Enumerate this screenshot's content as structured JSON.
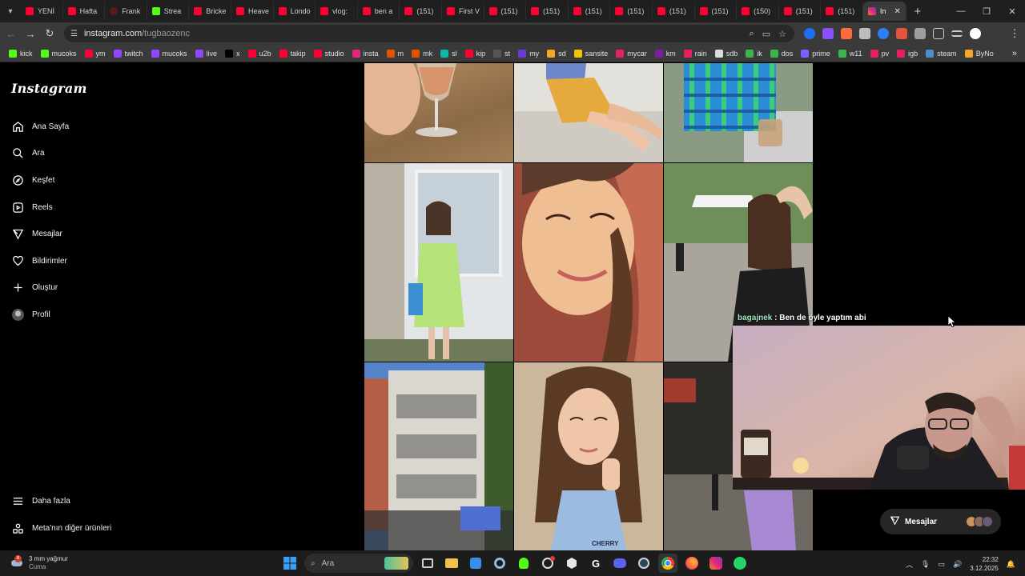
{
  "browser": {
    "tabs": [
      {
        "label": "YENİ",
        "icon": "youtube"
      },
      {
        "label": "Hafta",
        "icon": "youtube"
      },
      {
        "label": "Frank",
        "icon": "frank"
      },
      {
        "label": "Strea",
        "icon": "kick"
      },
      {
        "label": "Bricke",
        "icon": "youtube"
      },
      {
        "label": "Heave",
        "icon": "youtube"
      },
      {
        "label": "Londo",
        "icon": "youtube"
      },
      {
        "label": "vlog:",
        "icon": "youtube"
      },
      {
        "label": "ben a",
        "icon": "youtube"
      },
      {
        "label": "(151)",
        "icon": "youtube"
      },
      {
        "label": "First V",
        "icon": "youtube"
      },
      {
        "label": "(151)",
        "icon": "youtube"
      },
      {
        "label": "(151)",
        "icon": "youtube"
      },
      {
        "label": "(151)",
        "icon": "youtube"
      },
      {
        "label": "(151)",
        "icon": "youtube"
      },
      {
        "label": "(151)",
        "icon": "youtube"
      },
      {
        "label": "(151)",
        "icon": "youtube"
      },
      {
        "label": "(150)",
        "icon": "youtube"
      },
      {
        "label": "(151)",
        "icon": "youtube"
      },
      {
        "label": "(151)",
        "icon": "youtube"
      }
    ],
    "active_tab_label": "In",
    "address": {
      "host": "instagram.com",
      "path": "/tugbaozenc"
    },
    "bookmarks": [
      {
        "label": "kick",
        "color": "#53fc18"
      },
      {
        "label": "mucoks",
        "color": "#53fc18"
      },
      {
        "label": "ym",
        "color": "#ff0033"
      },
      {
        "label": "twitch",
        "color": "#9146ff"
      },
      {
        "label": "mucoks",
        "color": "#9146ff"
      },
      {
        "label": "live",
        "color": "#9146ff"
      },
      {
        "label": "x",
        "color": "#000000"
      },
      {
        "label": "u2b",
        "color": "#ff0033"
      },
      {
        "label": "takip",
        "color": "#ff0033"
      },
      {
        "label": "studio",
        "color": "#ff0033"
      },
      {
        "label": "insta",
        "color": "#dd2a7b"
      },
      {
        "label": "m",
        "color": "#e65100"
      },
      {
        "label": "mk",
        "color": "#e65100"
      },
      {
        "label": "sl",
        "color": "#0fb5a6"
      },
      {
        "label": "kip",
        "color": "#ff0033"
      },
      {
        "label": "st",
        "color": "#555555"
      },
      {
        "label": "my",
        "color": "#6e3ad6"
      },
      {
        "label": "sd",
        "color": "#f5a623"
      },
      {
        "label": "sansite",
        "color": "#f5c400"
      },
      {
        "label": "mycar",
        "color": "#e0245e"
      },
      {
        "label": "km",
        "color": "#7b1fa2"
      },
      {
        "label": "rain",
        "color": "#e91e63"
      },
      {
        "label": "sdb",
        "color": "#dddddd"
      },
      {
        "label": "ik",
        "color": "#3bb54a"
      },
      {
        "label": "dos",
        "color": "#3bb54a"
      },
      {
        "label": "prime",
        "color": "#7b61ff"
      },
      {
        "label": "w11",
        "color": "#3bb54a"
      },
      {
        "label": "pv",
        "color": "#e91e63"
      },
      {
        "label": "igb",
        "color": "#e91e63"
      },
      {
        "label": "steam",
        "color": "#4c8ec9"
      },
      {
        "label": "ByNo",
        "color": "#f5a623"
      }
    ]
  },
  "instagram": {
    "logo": "Instagram",
    "nav": [
      {
        "label": "Ana Sayfa",
        "icon": "home-icon"
      },
      {
        "label": "Ara",
        "icon": "search-icon"
      },
      {
        "label": "Keşfet",
        "icon": "compass-icon"
      },
      {
        "label": "Reels",
        "icon": "reels-icon"
      },
      {
        "label": "Mesajlar",
        "icon": "send-icon"
      },
      {
        "label": "Bildirimler",
        "icon": "heart-icon"
      },
      {
        "label": "Oluştur",
        "icon": "plus-icon"
      },
      {
        "label": "Profil",
        "icon": "avatar-icon"
      }
    ],
    "more": "Daha fazla",
    "meta": "Meta'nın diğer ürünleri",
    "messages_pill": "Mesajlar",
    "photo_text": "CHERRY"
  },
  "stream_overlay": {
    "chat_user": "bagajnek",
    "chat_message": "Ben de öyle yaptım abi"
  },
  "taskbar": {
    "weather_text": "3 mm yağmur",
    "weather_day": "Cuma",
    "weather_badge": "8",
    "search_placeholder": "Ara",
    "time": "22:32",
    "date": "3.12.2025"
  }
}
